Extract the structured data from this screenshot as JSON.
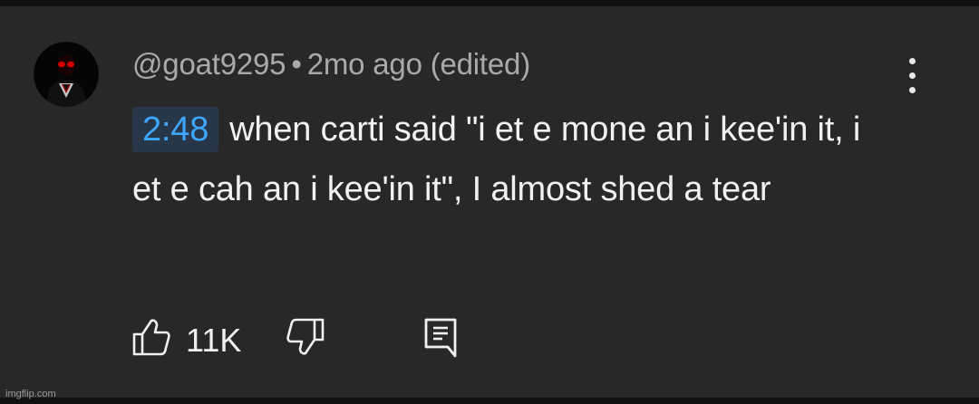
{
  "comment": {
    "author": "@goat9295",
    "separator": "•",
    "time": "2mo ago (edited)",
    "timestamp_link": "2:48",
    "text": "when carti said \"i et e mone an i kee'in it, i et e cah an i kee'in it\", I almost shed a tear",
    "like_count": "11K"
  },
  "icons": {
    "avatar": "avatar",
    "more": "more-vert-icon",
    "like": "thumb-up-icon",
    "dislike": "thumb-down-icon",
    "reply": "reply-comment-icon"
  },
  "watermark": "imgflip.com",
  "colors": {
    "background": "#282828",
    "text": "#f1f1f1",
    "meta": "#aaaaaa",
    "link": "#3ea6ff",
    "link_bg": "#273648"
  }
}
